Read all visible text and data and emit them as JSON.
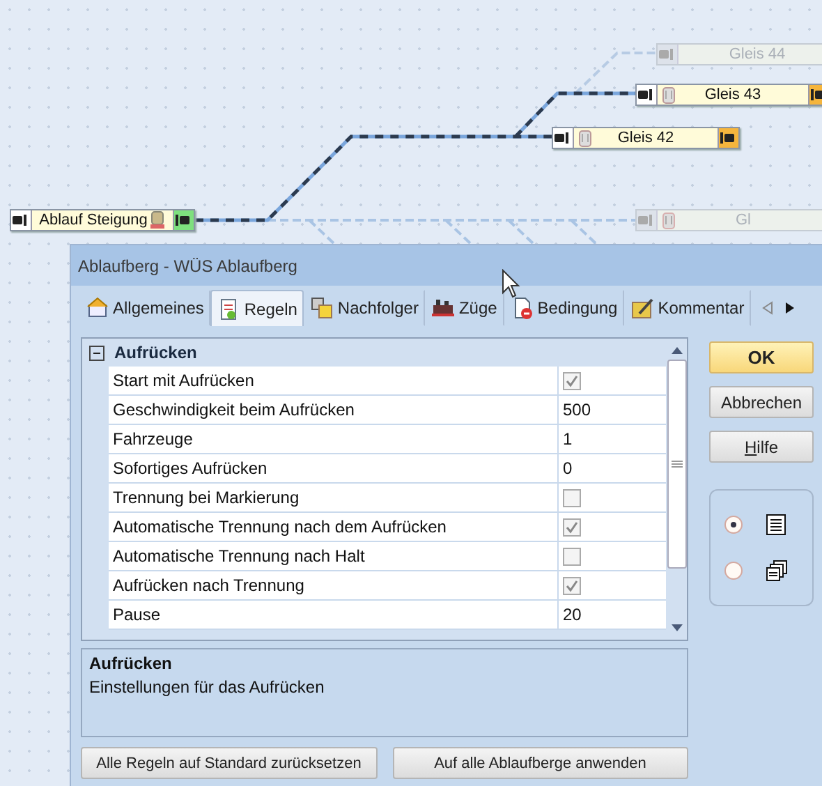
{
  "canvas": {
    "nodes": [
      {
        "label": "Ablauf Steigung",
        "faded": false,
        "color": "#7ee07e"
      },
      {
        "label": "Gleis 42",
        "faded": false,
        "color": "#f5b53d"
      },
      {
        "label": "Gleis 43",
        "faded": false,
        "color": "#f5b53d"
      },
      {
        "label": "Gleis 44",
        "faded": true
      },
      {
        "label": "Gl",
        "faded": true
      }
    ]
  },
  "dialog": {
    "title": "Ablaufberg - WÜS Ablaufberg",
    "tabs": [
      {
        "label": "Allgemeines",
        "selected": false
      },
      {
        "label": "Regeln",
        "selected": true
      },
      {
        "label": "Nachfolger",
        "selected": false
      },
      {
        "label": "Züge",
        "selected": false
      },
      {
        "label": "Bedingung",
        "selected": false
      },
      {
        "label": "Kommentar",
        "selected": false
      }
    ],
    "grid": {
      "group": "Aufrücken",
      "expanded": true,
      "rows": [
        {
          "name": "Start mit Aufrücken",
          "kind": "check",
          "checked": true
        },
        {
          "name": "Geschwindigkeit beim Aufrücken",
          "kind": "value",
          "value": "500"
        },
        {
          "name": "Fahrzeuge",
          "kind": "value",
          "value": "1"
        },
        {
          "name": "Sofortiges Aufrücken",
          "kind": "value",
          "value": "0"
        },
        {
          "name": "Trennung bei Markierung",
          "kind": "check",
          "checked": false
        },
        {
          "name": "Automatische Trennung nach dem Aufrücken",
          "kind": "check",
          "checked": true
        },
        {
          "name": "Automatische Trennung nach Halt",
          "kind": "check",
          "checked": false
        },
        {
          "name": "Aufrücken nach Trennung",
          "kind": "check",
          "checked": true
        },
        {
          "name": "Pause",
          "kind": "value",
          "value": "20"
        }
      ]
    },
    "description": {
      "title": "Aufrücken",
      "text": "Einstellungen für das Aufrücken"
    },
    "side_buttons": [
      "OK",
      "Abbrechen",
      "Hilfe"
    ],
    "view_options": [
      {
        "selected": true
      },
      {
        "selected": false
      }
    ],
    "bottom_buttons": [
      "Alle Regeln auf Standard zurücksetzen",
      "Auf alle Ablaufberge anwenden"
    ]
  }
}
